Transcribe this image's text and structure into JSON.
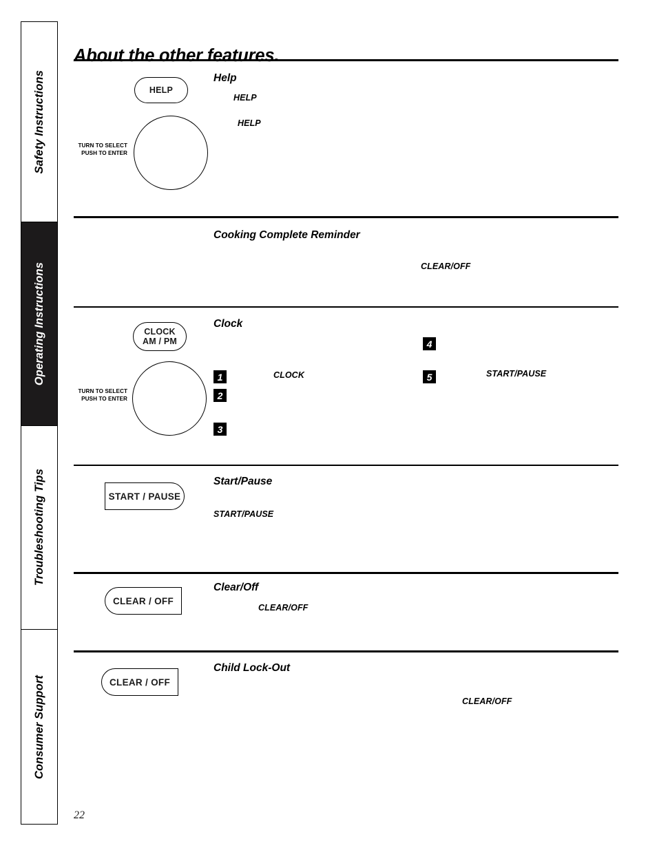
{
  "page": {
    "title": "About the other features.",
    "number": "22"
  },
  "sidebar": {
    "tabs": [
      {
        "label": "Safety Instructions",
        "active": false
      },
      {
        "label": "Operating Instructions",
        "active": true
      },
      {
        "label": "Troubleshooting Tips",
        "active": false
      },
      {
        "label": "Consumer Support",
        "active": false
      }
    ]
  },
  "sections": [
    {
      "id": "help",
      "heading": "Help",
      "button_label": "HELP",
      "knob_caption_line1": "TURN TO SELECT",
      "knob_caption_line2": "PUSH TO ENTER",
      "labels": [
        "HELP",
        "HELP"
      ]
    },
    {
      "id": "cooking-complete-reminder",
      "heading": "Cooking Complete Reminder",
      "labels": [
        "CLEAR/OFF"
      ]
    },
    {
      "id": "clock",
      "heading": "Clock",
      "button_line1": "CLOCK",
      "button_line2": "AM / PM",
      "knob_caption_line1": "TURN TO SELECT",
      "knob_caption_line2": "PUSH TO ENTER",
      "steps": [
        "1",
        "2",
        "3",
        "4",
        "5"
      ],
      "labels": [
        "CLOCK",
        "START/PAUSE"
      ]
    },
    {
      "id": "start-pause",
      "heading": "Start/Pause",
      "button_label": "START / PAUSE",
      "labels": [
        "START/PAUSE"
      ]
    },
    {
      "id": "clear-off",
      "heading": "Clear/Off",
      "button_label": "CLEAR / OFF",
      "labels": [
        "CLEAR/OFF"
      ]
    },
    {
      "id": "child-lock-out",
      "heading": "Child Lock-Out",
      "button_label": "CLEAR / OFF",
      "labels": [
        "CLEAR/OFF"
      ]
    }
  ]
}
